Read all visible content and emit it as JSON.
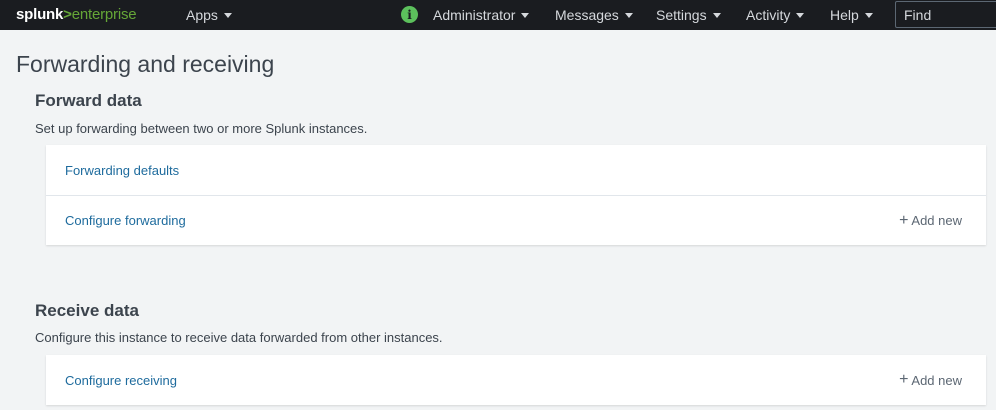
{
  "topbar": {
    "logo_brand": "splunk",
    "logo_caret": ">",
    "logo_product": "enterprise",
    "apps_label": "Apps",
    "info_glyph": "i",
    "administrator_label": "Administrator",
    "messages_label": "Messages",
    "settings_label": "Settings",
    "activity_label": "Activity",
    "help_label": "Help",
    "find_placeholder": "Find"
  },
  "page": {
    "title": "Forwarding and receiving"
  },
  "forward": {
    "title": "Forward data",
    "description": "Set up forwarding between two or more Splunk instances.",
    "rows": [
      {
        "label": "Forwarding defaults"
      },
      {
        "label": "Configure forwarding",
        "action": "Add new"
      }
    ]
  },
  "receive": {
    "title": "Receive data",
    "description": "Configure this instance to receive data forwarded from other instances.",
    "rows": [
      {
        "label": "Configure receiving",
        "action": "Add new"
      }
    ]
  },
  "icons": {
    "info": "info-circle-icon",
    "chevron": "chevron-down-icon",
    "plus": "plus-icon"
  },
  "colors": {
    "topbar_bg": "#1a1c20",
    "brand_green": "#65a637",
    "link_blue": "#1e6b9d",
    "page_bg": "#f2f4f5"
  }
}
